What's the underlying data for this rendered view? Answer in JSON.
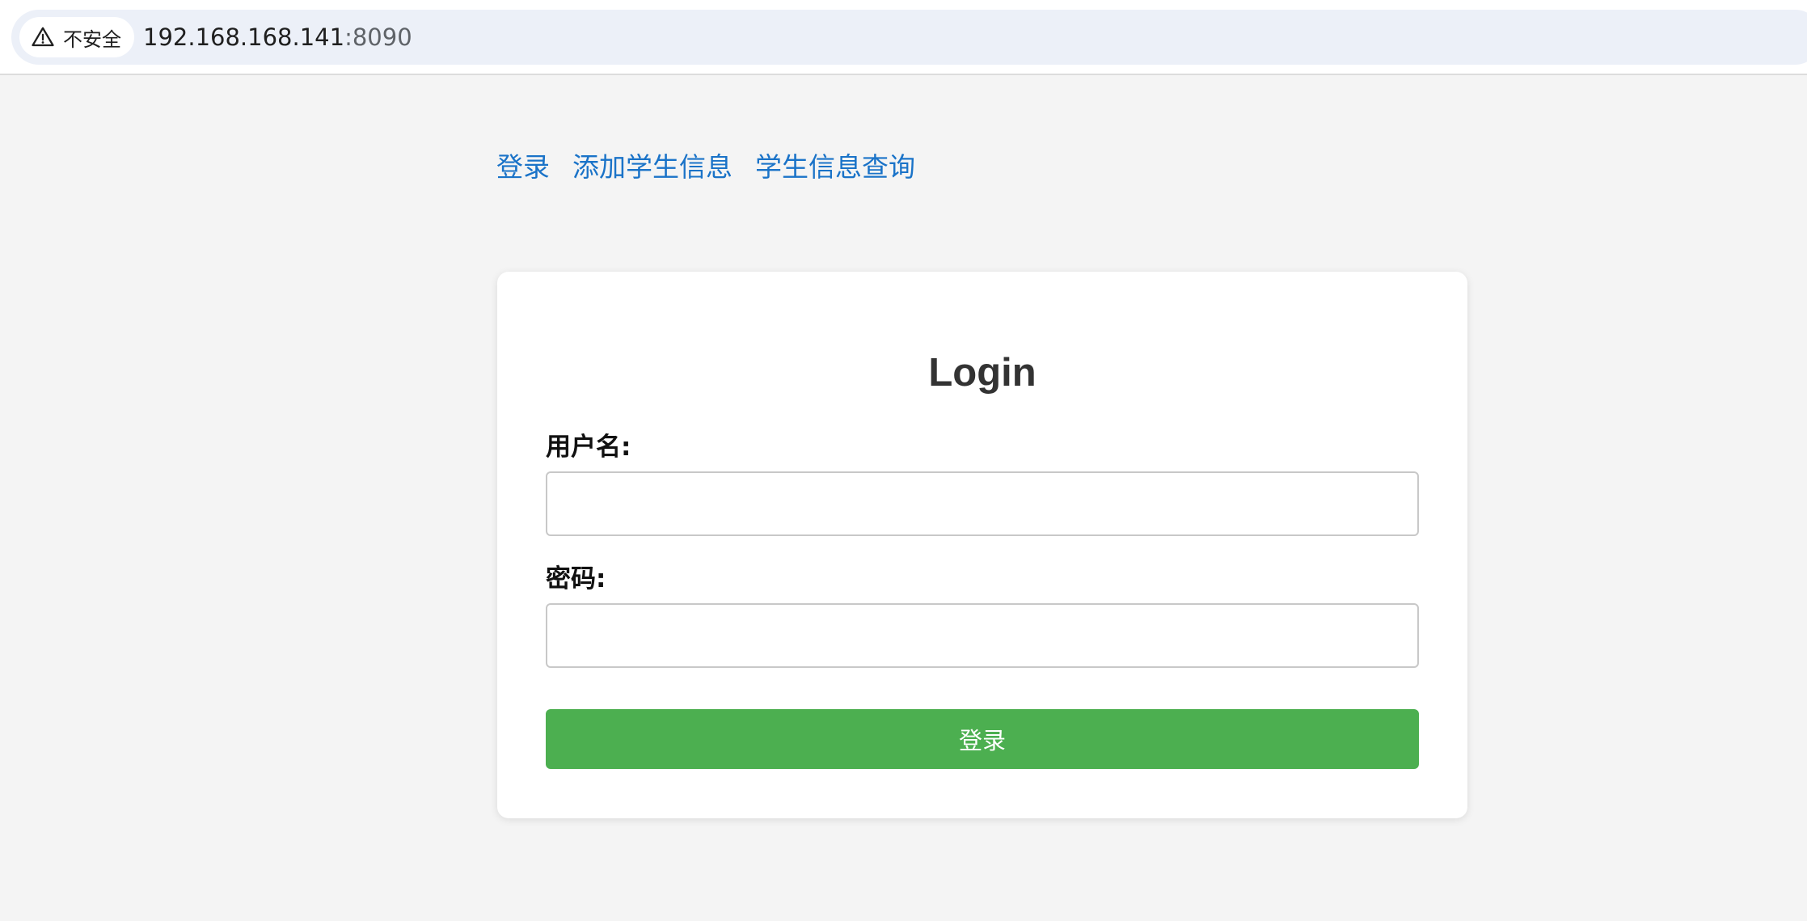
{
  "browser": {
    "security_label": "不安全",
    "url_host": "192.168.168.141",
    "url_port": ":8090"
  },
  "nav": {
    "items": [
      {
        "label": "登录"
      },
      {
        "label": "添加学生信息"
      },
      {
        "label": "学生信息查询"
      }
    ]
  },
  "login_form": {
    "title": "Login",
    "username_label": "用户名:",
    "username_value": "",
    "password_label": "密码:",
    "password_value": "",
    "submit_label": "登录"
  },
  "colors": {
    "link": "#1a73c8",
    "submit_bg": "#4caf50",
    "page_bg": "#f4f4f4"
  }
}
